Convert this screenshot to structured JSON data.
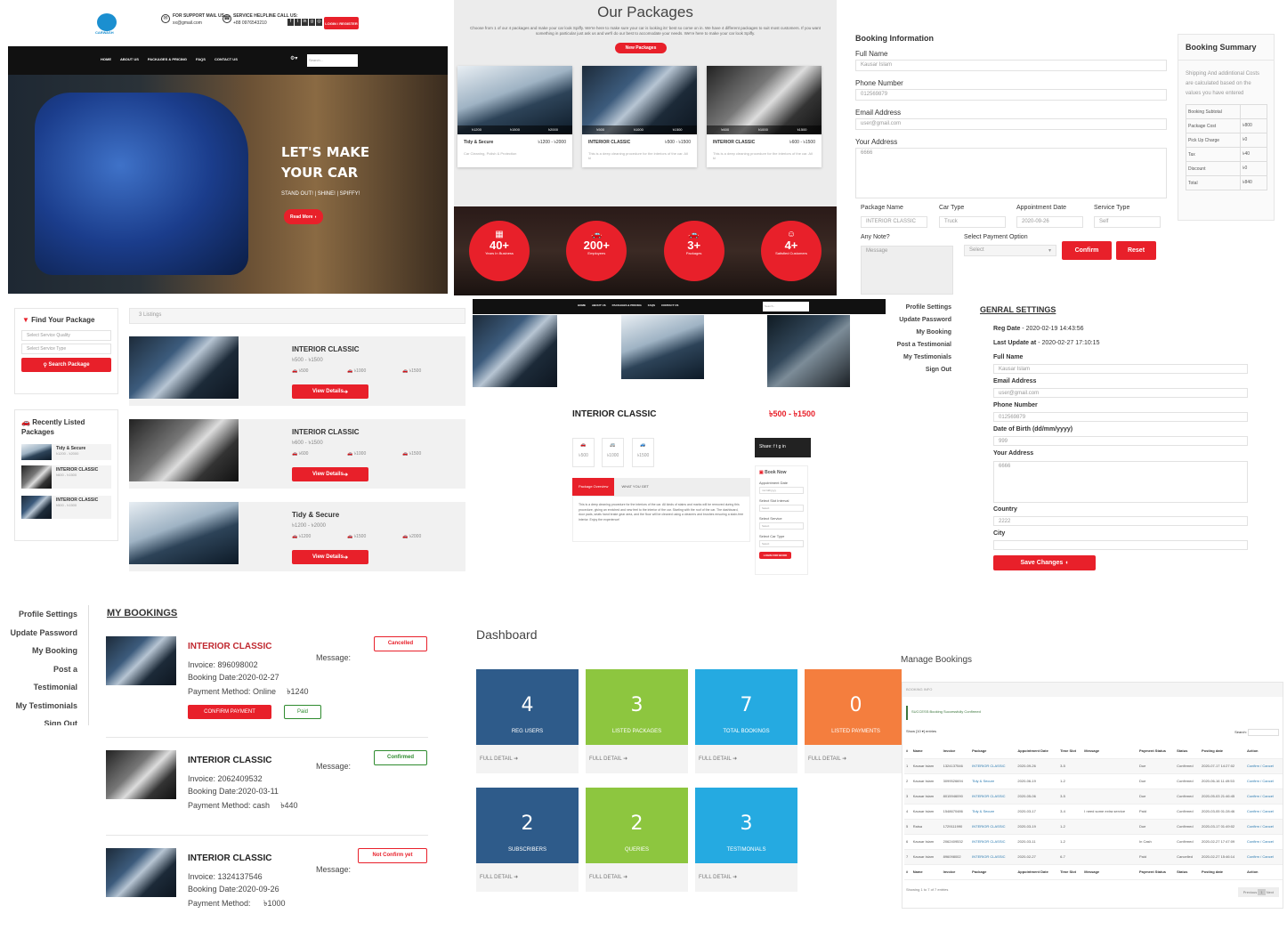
{
  "header": {
    "support_label": "FOR SUPPORT MAIL US :",
    "support_value": "xx@gmail.com",
    "helpline_label": "SERVICE HELPLINE CALL US:",
    "helpline_value": "+88 0976543210",
    "login_label": "LOGIN / REGISTER",
    "logo_text": "CARWASH"
  },
  "nav": [
    "HOME",
    "ABOUT US",
    "PACKAGES & PRICING",
    "FAQS",
    "CONTACT US"
  ],
  "search_placeholder": "Search...",
  "hero": {
    "line1": "LET'S MAKE",
    "line2": "YOUR CAR",
    "tagline": "STAND OUT! | SHINE! | SPIFFY!",
    "cta": "Read More"
  },
  "packages_section": {
    "title": "Our Packages",
    "intro": "Choose from 1 of our 4 packages and make your car look Spiffy. We're here to make sure your car is looking its' best so come on in. We have 4 different packages to suit most customers. If you want something in particular just ask us and we'll do our best to accomodate your needs. We're here to make your car look Spiffy.",
    "badge": "New Packages",
    "cards": [
      {
        "name": "Tidy & Secure",
        "price": "৳1200 - ৳2000",
        "desc": "Car Cleaning, Polish & Protection",
        "p1": "৳1200",
        "p2": "৳1500",
        "p3": "৳2000"
      },
      {
        "name": "INTERIOR CLASSIC",
        "price": "৳500 - ৳1500",
        "desc": "This is a deep cleaning procedure for the interiors of the car. All ki",
        "p1": "৳500",
        "p2": "৳1000",
        "p3": "৳1500"
      },
      {
        "name": "INTERIOR CLASSIC",
        "price": "৳600 - ৳1500",
        "desc": "This is a deep cleaning procedure for the interiors of the car. All ki",
        "p1": "৳600",
        "p2": "৳1000",
        "p3": "৳1500"
      }
    ]
  },
  "stats": [
    {
      "num": "40+",
      "label": "Years In Business"
    },
    {
      "num": "200+",
      "label": "Employees"
    },
    {
      "num": "3+",
      "label": "Packages"
    },
    {
      "num": "4+",
      "label": "Satisfied Customers"
    }
  ],
  "booking_info": {
    "title": "Booking Information",
    "full_name_label": "Full Name",
    "full_name": "Kausar Islam",
    "phone_label": "Phone Number",
    "phone": "012569879",
    "email_label": "Email Address",
    "email": "user@gmail.com",
    "address_label": "Your Address",
    "address": "6666",
    "package_label": "Package Name",
    "package": "INTERIOR CLASSIC",
    "cartype_label": "Car Type",
    "cartype": "Truck",
    "date_label": "Appointment Date",
    "date": "2020-09-26",
    "service_label": "Service Type",
    "service": "Self",
    "note_label": "Any Note?",
    "note_placeholder": "Message",
    "payment_label": "Select Payment Option",
    "payment_value": "Select",
    "confirm": "Confirm",
    "reset": "Reset"
  },
  "booking_summary": {
    "title": "Booking Summary",
    "note": "Shipping And addintional Costs are calculated based on the values you have entered",
    "rows": [
      [
        "Booking Subtotal",
        ""
      ],
      [
        "Package Cost",
        "৳800"
      ],
      [
        "Pick Up Charge",
        "৳0"
      ],
      [
        "Tax",
        "৳40"
      ],
      [
        "Discount",
        "৳0"
      ],
      [
        "Total",
        "৳840"
      ]
    ]
  },
  "find_package": {
    "title": "Find Your Package",
    "select1": "Select Service Quality",
    "select2": "Select Service Type",
    "button": "Search Package"
  },
  "recent": {
    "title": "Recently Listed Packages",
    "items": [
      {
        "name": "Tidy & Secure",
        "price": "৳1200 - ৳2000"
      },
      {
        "name": "INTERIOR CLASSIC",
        "price": "৳600 - ৳1500"
      },
      {
        "name": "INTERIOR CLASSIC",
        "price": "৳500 - ৳1500"
      }
    ]
  },
  "listings": {
    "count": "3 Listings",
    "details": "View Details",
    "items": [
      {
        "name": "INTERIOR CLASSIC",
        "price": "৳500 - ৳1500",
        "p1": "৳500",
        "p2": "৳1000",
        "p3": "৳1500"
      },
      {
        "name": "INTERIOR CLASSIC",
        "price": "৳600 - ৳1500",
        "p1": "৳600",
        "p2": "৳1000",
        "p3": "৳1500"
      },
      {
        "name": "Tidy & Secure",
        "price": "৳1200 - ৳2000",
        "p1": "৳1200",
        "p2": "৳1500",
        "p3": "৳2000"
      }
    ]
  },
  "detail": {
    "title": "INTERIOR CLASSIC",
    "price": "৳500 - ৳1500",
    "p1": "৳500",
    "p2": "৳1000",
    "p3": "৳1500",
    "tab1": "Package Overview",
    "tab2": "WHAT YOU GET",
    "overview": "This is a deep cleaning procedure for the interiors of the car. All kinds of stains and marks will be removed during this procedure, giving an enriched and new feel to the interior of the car. Starting with the roof of the car. The dashboard, door pads, seats hand brake gear area, and the floor will be cleaned using a cleaners and brushes ensuring a stain-free interior. Enjoy the experience!",
    "share": "Share:",
    "book": "Book Now",
    "f1": "Appointment Date",
    "f1v": "mm/dd/yyyy",
    "f2": "Select Slot Interval",
    "f3": "Select Service",
    "f4": "Select Car Type",
    "sel": "Select",
    "login": "LOGIN FOR BOOK"
  },
  "side_menu": [
    "Profile Settings",
    "Update Password",
    "My Booking",
    "Post a Testimonial",
    "My Testimonials",
    "Sign Out"
  ],
  "settings": {
    "title": "GENRAL SETTINGS",
    "reg_label": "Reg Date",
    "reg": "- 2020-02-19 14:43:56",
    "upd_label": "Last Update at",
    "upd": "- 2020-02-27 17:10:15",
    "name_label": "Full Name",
    "name": "Kausar Islam",
    "email_label": "Email Address",
    "email": "user@gmail.com",
    "phone_label": "Phone Number",
    "phone": "012569879",
    "dob_label": "Date of Birth (dd/mm/yyyy)",
    "dob": "999",
    "addr_label": "Your Address",
    "addr": "6666",
    "country_label": "Country",
    "country": "2222",
    "city_label": "City",
    "save": "Save Changes"
  },
  "my_bookings": {
    "title": "MY BOOKINGS",
    "message_label": "Message:",
    "items": [
      {
        "name": "INTERIOR CLASSIC",
        "invoice": "896098002",
        "date": "2020-02-27",
        "method": "Online",
        "amount": "৳1240",
        "status": "Cancelled",
        "confirm": "CONFIRM PAYMENT",
        "paid": "Paid"
      },
      {
        "name": "INTERIOR CLASSIC",
        "invoice": "2062409532",
        "date": "2020-03-11",
        "method": "cash",
        "amount": "৳440",
        "status": "Confirmed"
      },
      {
        "name": "INTERIOR CLASSIC",
        "invoice": "1324137546",
        "date": "2020-09-26",
        "method": "",
        "amount": "৳1000",
        "status": "Not Confirm yet"
      }
    ]
  },
  "dashboard": {
    "title": "Dashboard",
    "detail": "FULL DETAIL",
    "tiles": [
      {
        "num": "4",
        "label": "REG USERS",
        "color": "#2e5b8a"
      },
      {
        "num": "3",
        "label": "LISTED PACKAGES",
        "color": "#8dc63f"
      },
      {
        "num": "7",
        "label": "TOTAL BOOKINGS",
        "color": "#25aae1"
      },
      {
        "num": "0",
        "label": "LISTED PAYMENTS",
        "color": "#f47e3e"
      },
      {
        "num": "2",
        "label": "SUBSCRIBERS",
        "color": "#2e5b8a"
      },
      {
        "num": "2",
        "label": "QUERIES",
        "color": "#8dc63f"
      },
      {
        "num": "3",
        "label": "TESTIMONIALS",
        "color": "#25aae1"
      }
    ]
  },
  "manage": {
    "title": "Manage Bookings",
    "sub": "BOOKING INFO",
    "success": "SUCCESS:Booking Successfully Confirmed",
    "show": "Show",
    "entries": "entries",
    "search": "Search:",
    "footer": "Showing 1 to 7 of 7 entries",
    "prev": "Previous",
    "page": "1",
    "next": "Next",
    "cols": [
      "#",
      "Name",
      "Invoice",
      "Package",
      "Appointment Date",
      "Time Slot",
      "Message",
      "Payment Status",
      "Status",
      "Posting date",
      "Action"
    ],
    "rows": [
      [
        "1",
        "Kausar Islam",
        "1324137546",
        "INTERIOR CLASSIC",
        "2020-09-26",
        "3-5",
        "",
        "Due",
        "Confirmed",
        "2020-07-17 14:27:02",
        "Confirm / Cancel"
      ],
      [
        "2",
        "Kausar Islam",
        "3099526694",
        "Tidy & Secure",
        "2020-06-19",
        "1-2",
        "",
        "Due",
        "Confirmed",
        "2020-06-16 11:49:53",
        "Confirm / Cancel"
      ],
      [
        "3",
        "Kausar Islam",
        "8015946090",
        "INTERIOR CLASSIC",
        "2020-05-06",
        "3-5",
        "",
        "Due",
        "Confirmed",
        "2020-05-03 21:46:45",
        "Confirm / Cancel"
      ],
      [
        "4",
        "Kausar Islam",
        "1548670486",
        "Tidy & Secure",
        "2020-03-17",
        "3-4",
        "I need some extra service",
        "Paid",
        "Confirmed",
        "2020-03-05 01:28:46",
        "Confirm / Cancel"
      ],
      [
        "5",
        "Raisa",
        "1729111990",
        "INTERIOR CLASSIC",
        "2020-03-19",
        "1-2",
        "",
        "Due",
        "Confirmed",
        "2020-03-17 01:49:02",
        "Confirm / Cancel"
      ],
      [
        "6",
        "Kausar Islam",
        "2062409532",
        "INTERIOR CLASSIC",
        "2020-03-11",
        "1-2",
        "",
        "In Cash",
        "Confirmed",
        "2020-02-27 17:47:09",
        "Confirm / Cancel"
      ],
      [
        "7",
        "Kausar Islam",
        "896098002",
        "INTERIOR CLASSIC",
        "2020-02-27",
        "6-7",
        "",
        "Paid",
        "Cancelled",
        "2020-02-27 15:46:14",
        "Confirm / Cancel"
      ]
    ]
  }
}
